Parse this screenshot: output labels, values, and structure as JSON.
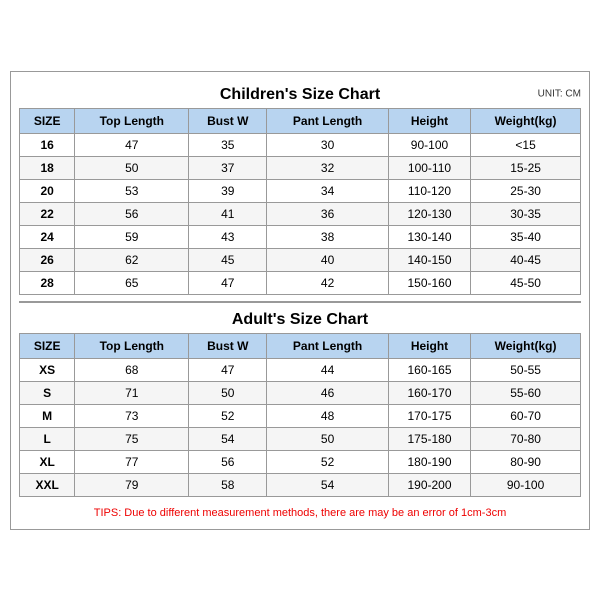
{
  "children_title": "Children's Size Chart",
  "adult_title": "Adult's Size Chart",
  "unit": "UNIT: CM",
  "tips": "TIPS: Due to different measurement methods, there are may be an error of 1cm-3cm",
  "columns": [
    "SIZE",
    "Top Length",
    "Bust W",
    "Pant Length",
    "Height",
    "Weight(kg)"
  ],
  "children_rows": [
    [
      "16",
      "47",
      "35",
      "30",
      "90-100",
      "<15"
    ],
    [
      "18",
      "50",
      "37",
      "32",
      "100-110",
      "15-25"
    ],
    [
      "20",
      "53",
      "39",
      "34",
      "110-120",
      "25-30"
    ],
    [
      "22",
      "56",
      "41",
      "36",
      "120-130",
      "30-35"
    ],
    [
      "24",
      "59",
      "43",
      "38",
      "130-140",
      "35-40"
    ],
    [
      "26",
      "62",
      "45",
      "40",
      "140-150",
      "40-45"
    ],
    [
      "28",
      "65",
      "47",
      "42",
      "150-160",
      "45-50"
    ]
  ],
  "adult_rows": [
    [
      "XS",
      "68",
      "47",
      "44",
      "160-165",
      "50-55"
    ],
    [
      "S",
      "71",
      "50",
      "46",
      "160-170",
      "55-60"
    ],
    [
      "M",
      "73",
      "52",
      "48",
      "170-175",
      "60-70"
    ],
    [
      "L",
      "75",
      "54",
      "50",
      "175-180",
      "70-80"
    ],
    [
      "XL",
      "77",
      "56",
      "52",
      "180-190",
      "80-90"
    ],
    [
      "XXL",
      "79",
      "58",
      "54",
      "190-200",
      "90-100"
    ]
  ]
}
